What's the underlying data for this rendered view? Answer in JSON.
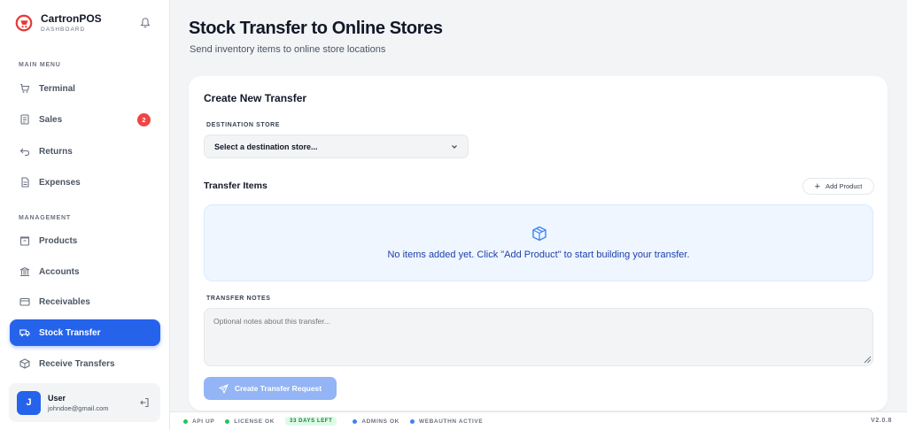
{
  "app": {
    "name": "CartronPOS",
    "subtitle": "DASHBOARD"
  },
  "sidebar": {
    "main_menu_label": "MAIN MENU",
    "management_label": "MANAGEMENT",
    "main_items": [
      {
        "label": "Terminal",
        "icon": "terminal-icon"
      },
      {
        "label": "Sales",
        "icon": "sales-icon",
        "badge": "2"
      },
      {
        "label": "Returns",
        "icon": "returns-icon"
      },
      {
        "label": "Expenses",
        "icon": "expenses-icon"
      }
    ],
    "management_items": [
      {
        "label": "Products",
        "icon": "products-icon"
      },
      {
        "label": "Accounts",
        "icon": "accounts-icon"
      },
      {
        "label": "Receivables",
        "icon": "receivables-icon"
      },
      {
        "label": "Stock Transfer",
        "icon": "truck-icon",
        "active": true
      },
      {
        "label": "Receive Transfers",
        "icon": "box-icon"
      }
    ],
    "user": {
      "initial": "J",
      "name": "User",
      "email": "johndoe@gmail.com"
    }
  },
  "page": {
    "title": "Stock Transfer to Online Stores",
    "subtitle": "Send inventory items to online store locations"
  },
  "form": {
    "card_title": "Create New Transfer",
    "destination_label": "DESTINATION STORE",
    "destination_value": "Select a destination store...",
    "items_title": "Transfer Items",
    "add_product_label": "Add Product",
    "empty_message": "No items added yet. Click \"Add Product\" to start building your transfer.",
    "notes_label": "TRANSFER NOTES",
    "notes_placeholder": "Optional notes about this transfer...",
    "submit_label": "Create Transfer Request"
  },
  "status": {
    "api": "API UP",
    "license": "LICENSE OK",
    "days_left": "33 DAYS LEFT",
    "admins": "ADMINS OK",
    "webauthn": "WEBAUTHN ACTIVE",
    "version": "V2.0.8"
  },
  "colors": {
    "accent": "#2563eb",
    "danger": "#ef4444",
    "success": "#22c55e",
    "brand": "#e53935"
  }
}
